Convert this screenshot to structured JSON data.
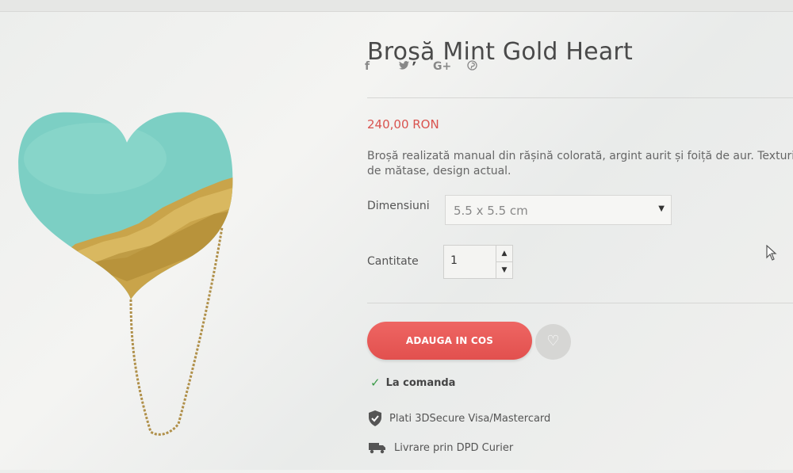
{
  "product": {
    "title": "Broșă Mint Gold Heart",
    "price": "240,00 RON",
    "description_lines": [
      "Broșă realizată manual din rășină colorată, argint aurit și foiță de aur. Texturi co",
      "de mătase, design actual."
    ]
  },
  "social": {
    "facebook": "f",
    "twitter": "🐦",
    "google_plus": "G+",
    "pinterest": "℗"
  },
  "options": {
    "size_label": "Dimensiuni",
    "size_value": "5.5 x 5.5 cm",
    "quantity_label": "Cantitate",
    "quantity_value": "1"
  },
  "actions": {
    "add_to_cart": "ADAUGA IN COS",
    "wishlist_icon": "heart-icon"
  },
  "availability": "La comanda",
  "info": {
    "payment": "Plati 3DSecure Visa/Mastercard",
    "delivery": "Livrare prin DPD Curier"
  },
  "colors": {
    "price": "#d9534f",
    "cart_button": "#e85a58",
    "check": "#3a9a48",
    "mint": "#7ccfc4",
    "gold": "#c9a44a"
  }
}
